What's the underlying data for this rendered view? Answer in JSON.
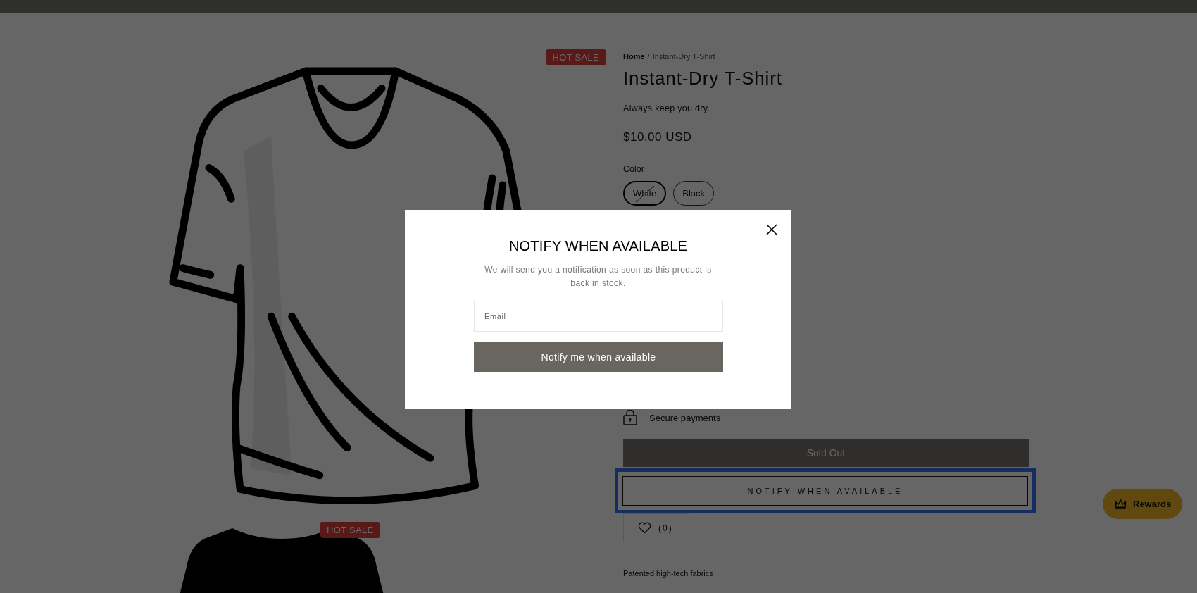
{
  "gallery": {
    "images": [
      {
        "kind": "outline",
        "badge": "HOT SALE"
      },
      {
        "kind": "filled",
        "badge": "HOT SALE"
      }
    ]
  },
  "product": {
    "breadcrumb": [
      {
        "label": "Home",
        "current": false
      },
      {
        "label": "Instant-Dry T-Shirt",
        "current": true
      }
    ],
    "breadcrumb_separator": "/",
    "title": "Instant-Dry T-Shirt",
    "subtitle": "Always keep you dry.",
    "price": "$10.00 USD",
    "option_label": "Color",
    "swatches": [
      {
        "label": "White",
        "selected": true,
        "available": false
      },
      {
        "label": "Black",
        "selected": false,
        "available": true
      }
    ],
    "secure_label": "Secure payments",
    "sold_out_button": {
      "label": "Sold Out",
      "disabled": true
    },
    "notify_button": {
      "label": "NOTIFY WHEN AVAILABLE",
      "highlighted": true
    },
    "wishlist": {
      "count": "(0)"
    },
    "feature": "Patented high-tech fabrics"
  },
  "modal": {
    "title": "NOTIFY WHEN AVAILABLE",
    "message": "We will send you a notification as soon as this product is back in stock.",
    "email_placeholder": "Email",
    "submit_label": "Notify me when available"
  },
  "rewards": {
    "label": "Rewards"
  }
}
